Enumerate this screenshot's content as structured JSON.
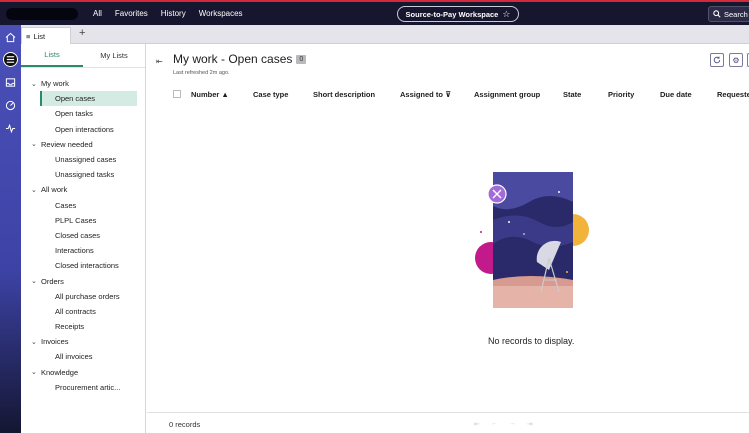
{
  "topnav": {
    "items": [
      "All",
      "Favorites",
      "History",
      "Workspaces"
    ],
    "workspace": "Source-to-Pay Workspace",
    "search_label": "Search"
  },
  "tabs": {
    "list_tab": "List",
    "add_tab": "+"
  },
  "sidebar": {
    "tabs": [
      "Lists",
      "My Lists"
    ],
    "groups": [
      {
        "label": "My work",
        "items": [
          "Open cases",
          "Open tasks",
          "Open interactions"
        ]
      },
      {
        "label": "Review needed",
        "items": [
          "Unassigned cases",
          "Unassigned tasks"
        ]
      },
      {
        "label": "All work",
        "items": [
          "Cases",
          "PLPL Cases",
          "Closed cases",
          "Interactions",
          "Closed interactions"
        ]
      },
      {
        "label": "Orders",
        "items": [
          "All purchase orders",
          "All contracts",
          "Receipts"
        ]
      },
      {
        "label": "Invoices",
        "items": [
          "All invoices"
        ]
      },
      {
        "label": "Knowledge",
        "items": [
          "Procurement artic..."
        ]
      }
    ]
  },
  "main": {
    "title": "My work - Open cases",
    "count": "0",
    "refreshed": "Last refreshed 2m ago.",
    "columns": [
      "Number ▲",
      "Case type",
      "Short description",
      "Assigned to ⊽",
      "Assignment group",
      "State",
      "Priority",
      "Due date",
      "Requeste"
    ],
    "empty_message": "No records to display.",
    "records": "0 records"
  },
  "colors": {
    "accent": "#2a8a6e",
    "topbar": "#16162e",
    "rail": "#4a50b8"
  }
}
